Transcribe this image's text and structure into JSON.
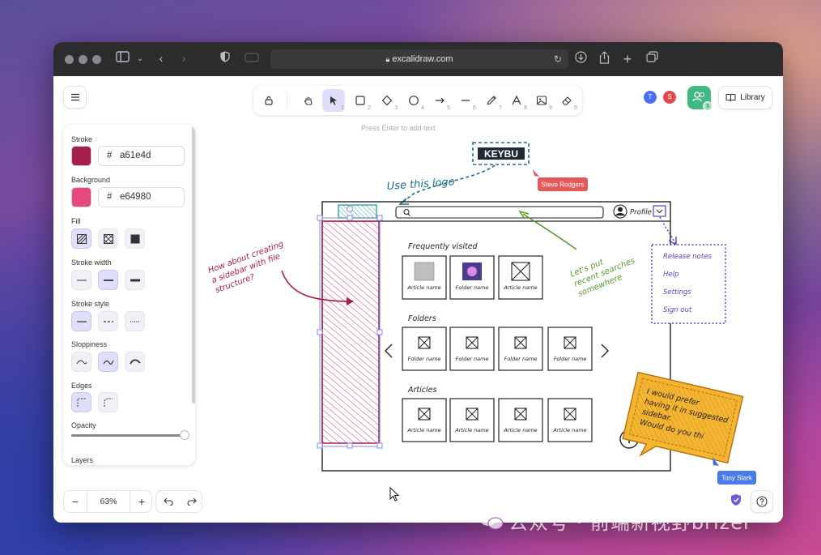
{
  "browser": {
    "url": "excalidraw.com"
  },
  "topbar": {
    "library_label": "Library",
    "collab_count": "3",
    "avatars": [
      {
        "initial": "T",
        "color": "#4a6cf7"
      },
      {
        "initial": "S",
        "color": "#e04a4a"
      }
    ]
  },
  "toolbar": {
    "tools": [
      {
        "name": "lock-icon",
        "key": ""
      },
      {
        "name": "hand-icon",
        "key": ""
      },
      {
        "name": "selection-icon",
        "key": "1"
      },
      {
        "name": "rectangle-icon",
        "key": "2"
      },
      {
        "name": "diamond-icon",
        "key": "3"
      },
      {
        "name": "ellipse-icon",
        "key": "4"
      },
      {
        "name": "arrow-icon",
        "key": "5"
      },
      {
        "name": "line-icon",
        "key": "6"
      },
      {
        "name": "pencil-icon",
        "key": "7"
      },
      {
        "name": "text-icon",
        "key": "8"
      },
      {
        "name": "image-icon",
        "key": "9"
      },
      {
        "name": "eraser-icon",
        "key": "0"
      }
    ],
    "hint": "Press Enter to add text"
  },
  "properties": {
    "stroke_label": "Stroke",
    "stroke_hash": "#",
    "stroke_hex": "a61e4d",
    "stroke_color": "#a61e4d",
    "background_label": "Background",
    "background_hash": "#",
    "background_hex": "e64980",
    "background_color": "#e64980",
    "fill_label": "Fill",
    "stroke_width_label": "Stroke width",
    "stroke_style_label": "Stroke style",
    "sloppiness_label": "Sloppiness",
    "edges_label": "Edges",
    "opacity_label": "Opacity",
    "opacity_value": 1.0,
    "layers_label": "Layers"
  },
  "footer": {
    "zoom": "63%",
    "zoom_out": "−",
    "zoom_in": "+"
  },
  "drawing": {
    "logo_text": "KEYBU",
    "use_logo_note": "Use this logo",
    "sidebar_note": "How about creating a sidebar with file structure?",
    "search_note": "Let's put recent searches somewhere",
    "profile_label": "Profile",
    "menu_items": [
      "Release notes",
      "Help",
      "Settings",
      "Sign out"
    ],
    "sticky_note": "I would prefer having it in suggested sidebar. Would do you thi",
    "sections": {
      "frequent": "Frequently visited",
      "folders": "Folders",
      "articles": "Articles"
    },
    "frequent_cards": [
      "Article name",
      "Folder name",
      "Article name"
    ],
    "folder_cards": [
      "Folder name",
      "Folder name",
      "Folder name",
      "Folder name"
    ],
    "article_cards": [
      "Article name",
      "Article name",
      "Article name",
      "Article name"
    ],
    "cursor_steve": "Steve Rodgers",
    "cursor_tony": "Tony Stark"
  },
  "watermark": "公众号 · 前端新视野brizer"
}
